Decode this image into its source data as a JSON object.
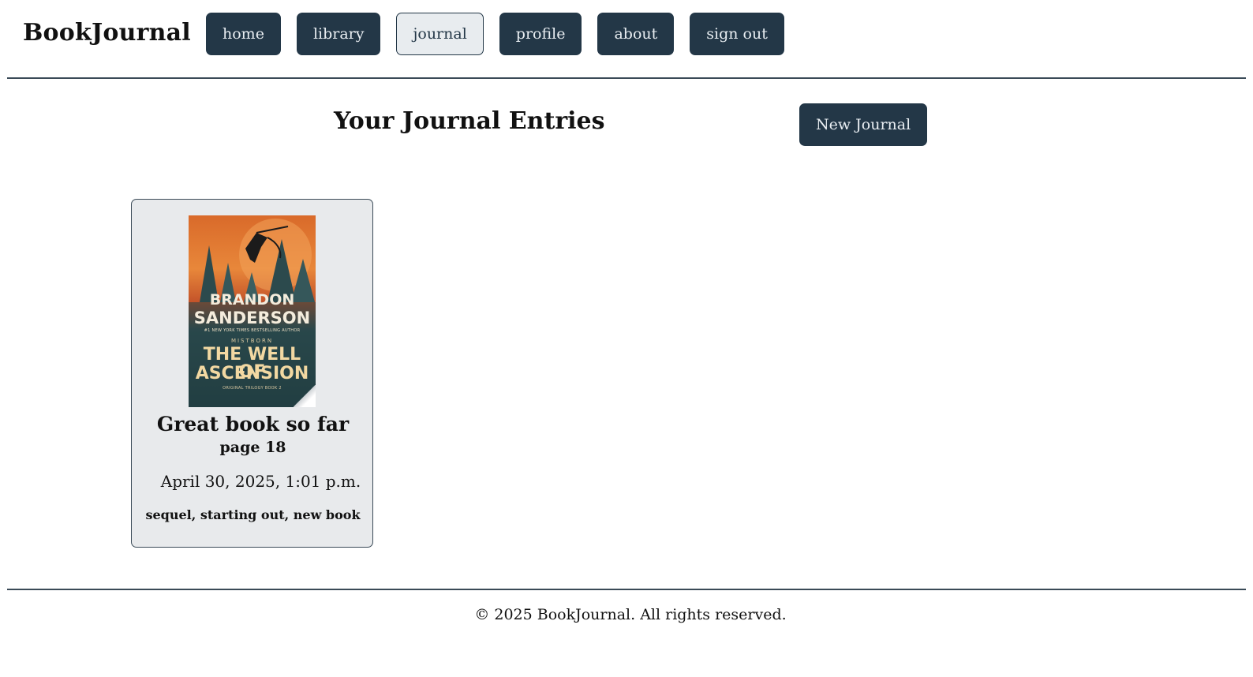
{
  "header": {
    "brand": "BookJournal",
    "nav": [
      {
        "label": "home"
      },
      {
        "label": "library"
      },
      {
        "label": "journal",
        "active": true
      },
      {
        "label": "profile"
      },
      {
        "label": "about"
      },
      {
        "label": "sign out"
      }
    ]
  },
  "main": {
    "title": "Your Journal Entries",
    "new_button_label": "New Journal",
    "entries": [
      {
        "cover": {
          "author_line1": "BRANDON",
          "author_line2": "SANDERSON",
          "tagline": "#1 NEW YORK TIMES BESTSELLING AUTHOR",
          "series": "MISTBORN",
          "title_line1": "THE WELL OF",
          "title_line2": "ASCENSION",
          "footnote": "ORIGINAL TRILOGY BOOK 2"
        },
        "title": "Great book so far",
        "page": "page 18",
        "date": "April 30, 2025, 1:01 p.m.",
        "tags": "sequel, starting out, new book"
      }
    ]
  },
  "footer": {
    "text": "© 2025 BookJournal. All rights reserved."
  },
  "colors": {
    "primary": "#233747",
    "card_bg": "#e8eaec",
    "active_bg": "#e8ecef",
    "rule": "#3a4a57"
  }
}
